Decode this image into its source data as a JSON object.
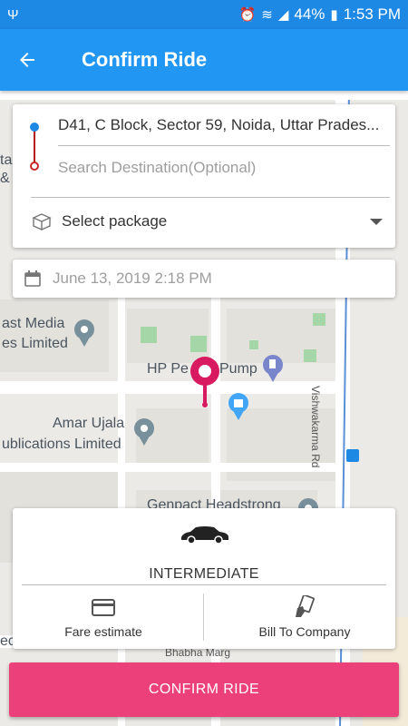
{
  "status_bar": {
    "battery": "44%",
    "time": "1:53 PM"
  },
  "header": {
    "title": "Confirm Ride"
  },
  "address": {
    "pickup": "D41, C Block, Sector 59, Noida, Uttar Prades...",
    "destination_placeholder": "Search Destination(Optional)"
  },
  "package": {
    "label": "Select package"
  },
  "schedule": {
    "datetime": "June 13, 2019 2:18 PM"
  },
  "map": {
    "labels": {
      "media": "ast Media",
      "media2": "es Limited",
      "hp": "HP Pe",
      "hp2": "Pump",
      "amar": "Amar Ujala",
      "amar2": "ublications Limited",
      "genpact": "Genpact Headstrong",
      "road": "Vishwakarma Rd",
      "bhabha": "Bhabha Marg",
      "edge1": "ta",
      "edge2": "&",
      "edge3": "ec"
    }
  },
  "ride": {
    "type": "INTERMEDIATE",
    "fare_label": "Fare estimate",
    "bill_label": "Bill To Company"
  },
  "actions": {
    "confirm": "CONFIRM RIDE"
  },
  "colors": {
    "primary": "#2196f3",
    "status_bar": "#1e88e5",
    "accent": "#ec407a",
    "marker": "#d81b60"
  }
}
